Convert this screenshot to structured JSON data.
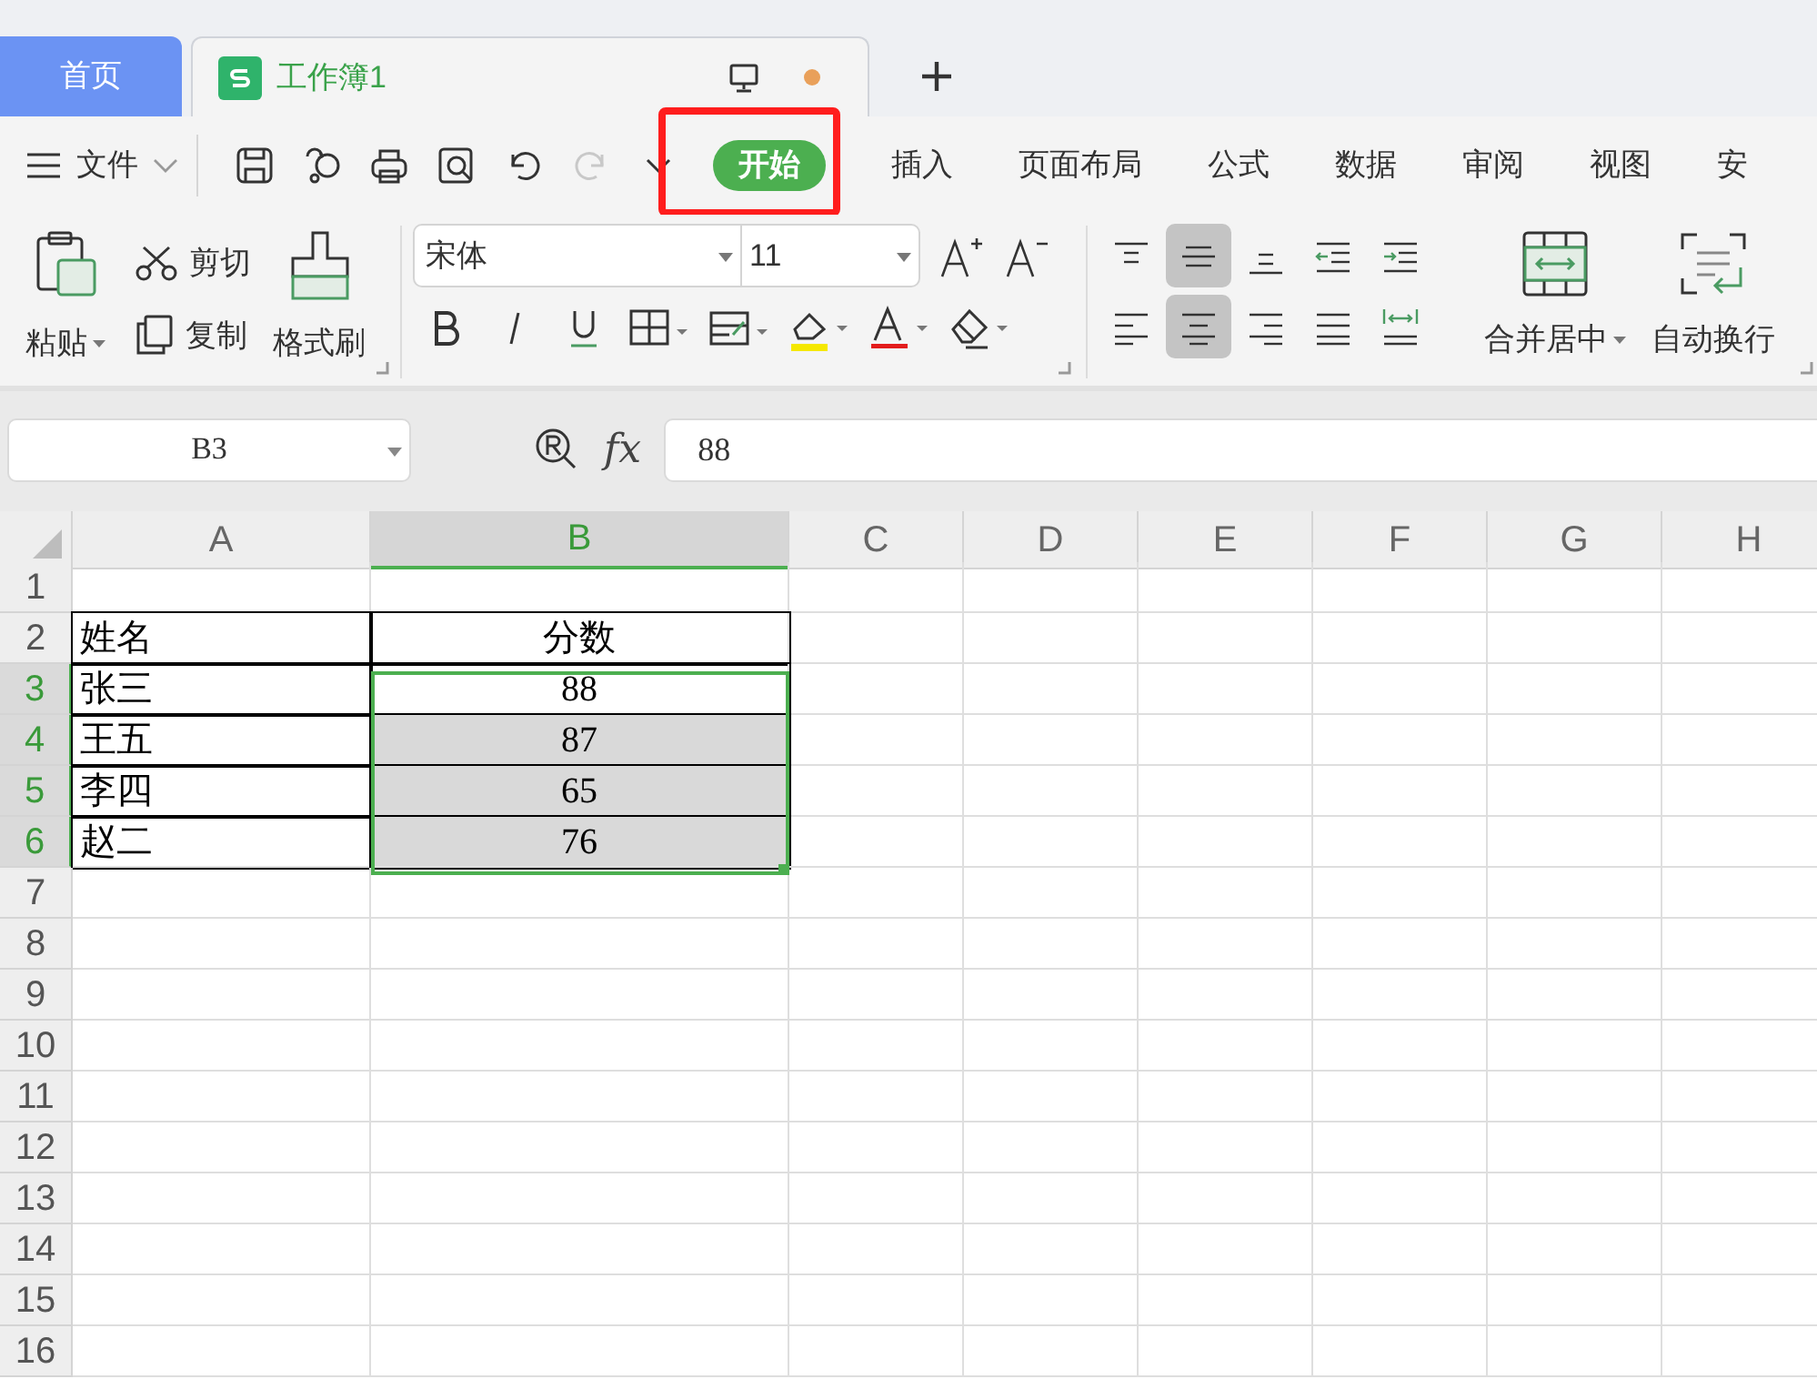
{
  "tabs": [
    {
      "label": "首页",
      "selected": false
    },
    {
      "label": "工作簿1",
      "selected": true,
      "unsaved": true
    }
  ],
  "file_menu": {
    "label": "文件"
  },
  "quick_access": [
    {
      "kind": "save",
      "disabled": false
    },
    {
      "kind": "convert",
      "disabled": false
    },
    {
      "kind": "print",
      "disabled": false
    },
    {
      "kind": "preview",
      "disabled": false
    },
    {
      "kind": "undo",
      "disabled": false
    },
    {
      "kind": "redo",
      "disabled": true
    },
    {
      "kind": "more",
      "disabled": false
    }
  ],
  "ribbon_tabs": [
    {
      "label": "开始",
      "selected": true,
      "highlighted": true
    },
    {
      "label": "插入",
      "selected": false,
      "highlighted": false
    },
    {
      "label": "页面布局",
      "selected": false,
      "highlighted": false
    },
    {
      "label": "公式",
      "selected": false,
      "highlighted": false
    },
    {
      "label": "数据",
      "selected": false,
      "highlighted": false
    },
    {
      "label": "审阅",
      "selected": false,
      "highlighted": false
    },
    {
      "label": "视图",
      "selected": false,
      "highlighted": false
    },
    {
      "label": "安",
      "selected": false,
      "highlighted": false
    }
  ],
  "clipboard": {
    "paste": "粘贴",
    "cut": "剪切",
    "copy": "复制",
    "format_painter": "格式刷"
  },
  "font": {
    "name": "宋体",
    "size": "11"
  },
  "align_buttons": [
    [
      {
        "kind": "top",
        "selected": false
      },
      {
        "kind": "middle",
        "selected": true
      },
      {
        "kind": "bottom",
        "selected": false
      },
      {
        "kind": "outdent",
        "selected": false
      },
      {
        "kind": "indent",
        "selected": false
      }
    ],
    [
      {
        "kind": "left",
        "selected": false
      },
      {
        "kind": "center",
        "selected": true
      },
      {
        "kind": "right",
        "selected": false
      },
      {
        "kind": "justify",
        "selected": false
      },
      {
        "kind": "distributed",
        "selected": false
      }
    ]
  ],
  "merge_label": "合并居中",
  "wrap_label": "自动换行",
  "name_box": "B3",
  "fx_label": "fx",
  "formula": "88",
  "columns": [
    {
      "label": "A",
      "selected": false
    },
    {
      "label": "B",
      "selected": true
    },
    {
      "label": "C",
      "selected": false
    },
    {
      "label": "D",
      "selected": false
    },
    {
      "label": "E",
      "selected": false
    },
    {
      "label": "F",
      "selected": false
    },
    {
      "label": "G",
      "selected": false
    },
    {
      "label": "H",
      "selected": false
    }
  ],
  "rows": [
    {
      "header": "1",
      "selected": false,
      "cells": []
    },
    {
      "header": "2",
      "selected": false,
      "cells": [
        {
          "text": "姓名",
          "bordered": true
        },
        {
          "text": "分数",
          "bordered": true
        }
      ]
    },
    {
      "header": "3",
      "selected": true,
      "cells": [
        {
          "text": "张三",
          "bordered": true
        },
        {
          "text": "88",
          "bordered": true,
          "selected": true,
          "active": true
        }
      ]
    },
    {
      "header": "4",
      "selected": true,
      "cells": [
        {
          "text": "王五",
          "bordered": true
        },
        {
          "text": "87",
          "bordered": true,
          "selected": true,
          "active": false
        }
      ]
    },
    {
      "header": "5",
      "selected": true,
      "cells": [
        {
          "text": "李四",
          "bordered": true
        },
        {
          "text": "65",
          "bordered": true,
          "selected": true,
          "active": false
        }
      ]
    },
    {
      "header": "6",
      "selected": true,
      "cells": [
        {
          "text": "赵二",
          "bordered": true
        },
        {
          "text": "76",
          "bordered": true,
          "selected": true,
          "active": false
        }
      ]
    },
    {
      "header": "7",
      "selected": false,
      "cells": []
    },
    {
      "header": "8",
      "selected": false,
      "cells": []
    },
    {
      "header": "9",
      "selected": false,
      "cells": []
    },
    {
      "header": "10",
      "selected": false,
      "cells": []
    },
    {
      "header": "11",
      "selected": false,
      "cells": []
    },
    {
      "header": "12",
      "selected": false,
      "cells": []
    },
    {
      "header": "13",
      "selected": false,
      "cells": []
    },
    {
      "header": "14",
      "selected": false,
      "cells": []
    },
    {
      "header": "15",
      "selected": false,
      "cells": []
    },
    {
      "header": "16",
      "selected": false,
      "cells": []
    }
  ]
}
